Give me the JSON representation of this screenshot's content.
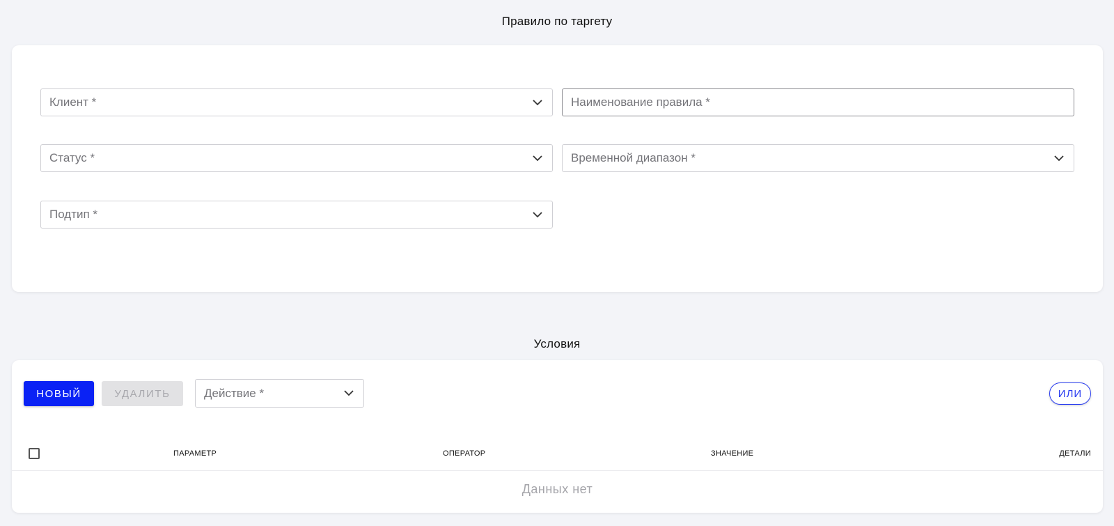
{
  "rule_section": {
    "title": "Правило по таргету",
    "fields": {
      "client": "Клиент *",
      "rule_name": "Наименование правила *",
      "status": "Статус *",
      "time_range": "Временной диапазон *",
      "subtype": "Подтип *"
    }
  },
  "conditions_section": {
    "title": "Условия",
    "toolbar": {
      "new_label": "НОВЫЙ",
      "delete_label": "УДАЛИТЬ",
      "action_label": "Действие *",
      "or_label": "ИЛИ"
    },
    "table": {
      "columns": [
        "ПАРАМЕТР",
        "ОПЕРАТОР",
        "ЗНАЧЕНИЕ",
        "ДЕТАЛИ"
      ],
      "empty_text": "Данных нет"
    }
  },
  "colors": {
    "accent": "#0a22f5",
    "background": "#f3f4f8"
  },
  "icons": {
    "dropdown": "chevron-down-icon",
    "select_all": "checkbox"
  }
}
